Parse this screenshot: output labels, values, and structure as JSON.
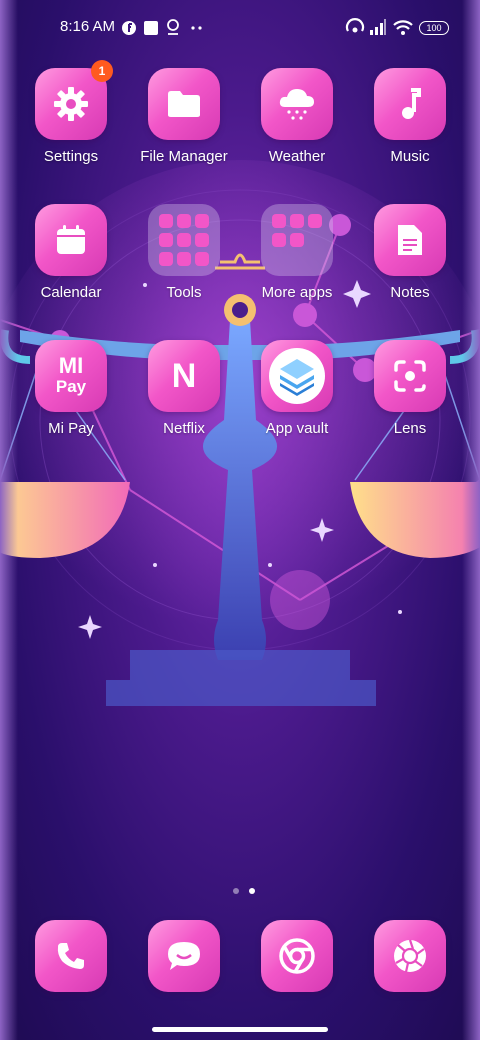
{
  "status_bar": {
    "time": "8:16 AM",
    "battery": "100",
    "icons": [
      "f-icon",
      "square-icon",
      "location-icon",
      "more-dots-icon",
      "hotspot-icon",
      "signal-icon",
      "wifi-icon",
      "battery-icon"
    ]
  },
  "apps": [
    {
      "label": "Settings",
      "icon": "gear-icon",
      "badge": "1"
    },
    {
      "label": "File Manager",
      "icon": "folder-icon"
    },
    {
      "label": "Weather",
      "icon": "snow-cloud-icon"
    },
    {
      "label": "Music",
      "icon": "music-note-icon"
    },
    {
      "label": "Calendar",
      "icon": "calendar-icon"
    },
    {
      "label": "Tools",
      "icon": "folder-tools"
    },
    {
      "label": "More apps",
      "icon": "folder-more-apps"
    },
    {
      "label": "Notes",
      "icon": "notes-icon"
    },
    {
      "label": "Mi Pay",
      "icon": "mipay-icon",
      "icon_text": "MI",
      "icon_subtext": "Pay"
    },
    {
      "label": "Netflix",
      "icon": "netflix-icon",
      "icon_text": "N"
    },
    {
      "label": "App vault",
      "icon": "app-vault-icon"
    },
    {
      "label": "Lens",
      "icon": "lens-icon"
    }
  ],
  "dock": [
    {
      "name": "phone",
      "icon": "phone-icon"
    },
    {
      "name": "messages",
      "icon": "chat-icon"
    },
    {
      "name": "chrome",
      "icon": "chrome-icon"
    },
    {
      "name": "camera",
      "icon": "camera-shutter-icon"
    }
  ],
  "page_indicator": {
    "pages": 2,
    "current": 2
  },
  "colors": {
    "tile_top": "#ff9be0",
    "tile_bottom": "#d73ab4",
    "badge": "#ff5a1f",
    "bg": "#2a0f6b"
  }
}
